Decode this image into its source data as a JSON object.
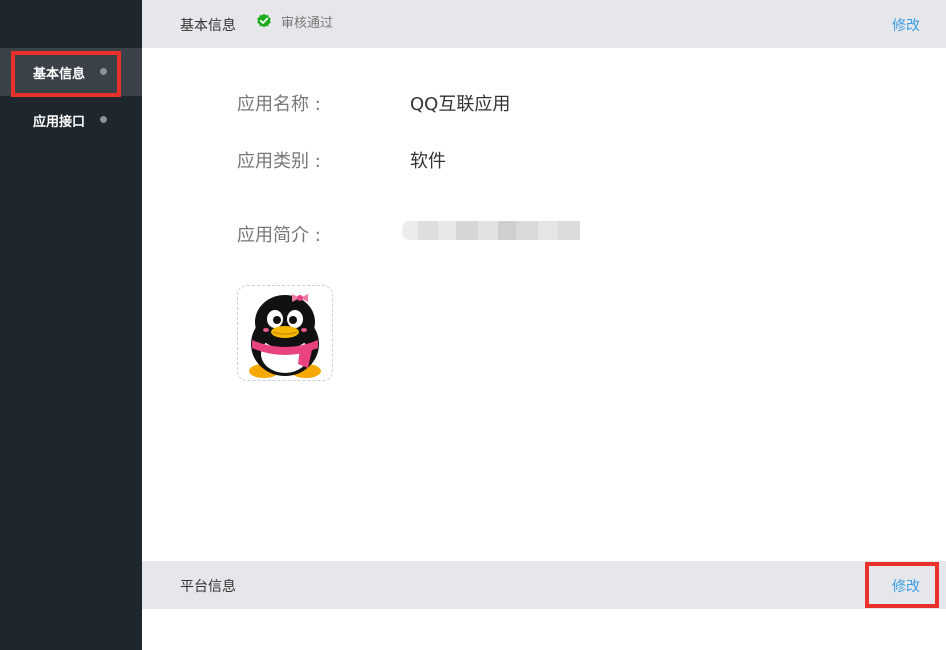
{
  "sidebar": {
    "items": [
      {
        "label": "基本信息",
        "active": true
      },
      {
        "label": "应用接口",
        "active": false
      }
    ]
  },
  "basic_info": {
    "title": "基本信息",
    "status": "审核通过",
    "status_icon": "check-badge-icon",
    "edit_label": "修改",
    "fields": {
      "name_label": "应用名称 :",
      "name_value": "QQ互联应用",
      "type_label": "应用类别 :",
      "type_value": "软件",
      "intro_label": "应用简介 :",
      "intro_value_note": "blurred"
    },
    "icon": "qq-penguin-icon"
  },
  "platform_info": {
    "title": "平台信息",
    "edit_label": "修改"
  },
  "colors": {
    "sidebar_bg": "#1f272e",
    "sidebar_active": "#3a4149",
    "header_bg": "#e6e7ea",
    "link": "#3a9ee4",
    "success": "#1aad19",
    "highlight": "#e8312b"
  }
}
